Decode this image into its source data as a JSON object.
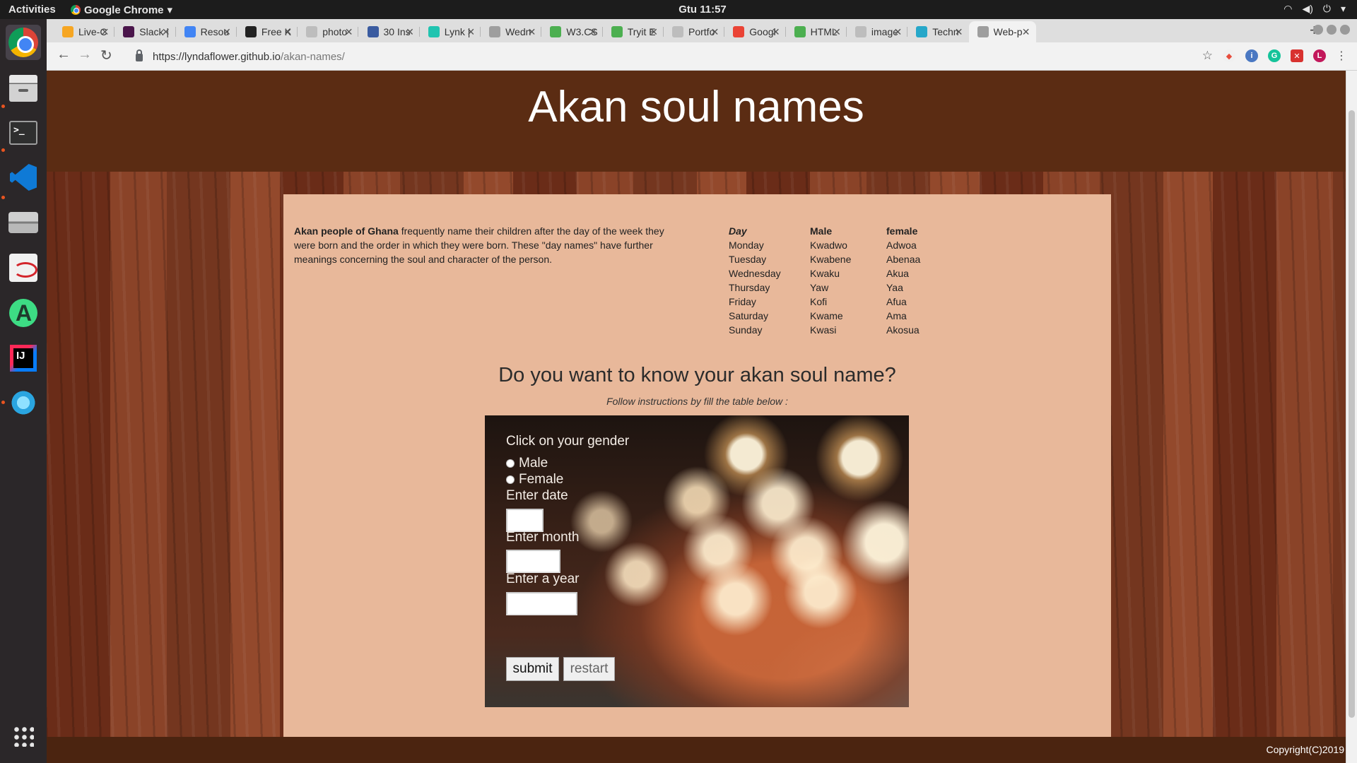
{
  "system": {
    "activities": "Activities",
    "app_name": "Google Chrome",
    "clock": "Gtu 11:57"
  },
  "dock": {
    "apps": [
      "chrome-icon",
      "files-icon",
      "terminal-icon",
      "vscode-icon",
      "scanner-icon",
      "document-viewer-icon",
      "android-studio-icon",
      "intellij-icon",
      "splash-app-icon",
      "show-applications-icon"
    ]
  },
  "browser": {
    "tabs": [
      {
        "title": "Live-C",
        "favicon_color": "#f6a623"
      },
      {
        "title": "Slack |",
        "favicon_color": "#4a154b"
      },
      {
        "title": "Resou",
        "favicon_color": "#4285f4"
      },
      {
        "title": "Free K",
        "favicon_color": "#222222"
      },
      {
        "title": "photo",
        "favicon_color": "#bdbdbd"
      },
      {
        "title": "30 Ins",
        "favicon_color": "#3a5ba0"
      },
      {
        "title": "Lynk |",
        "favicon_color": "#20c4b0"
      },
      {
        "title": "Wedn",
        "favicon_color": "#9e9e9e"
      },
      {
        "title": "W3.CS",
        "favicon_color": "#4caf50"
      },
      {
        "title": "Tryit E",
        "favicon_color": "#4caf50"
      },
      {
        "title": "Portfo",
        "favicon_color": "#bdbdbd"
      },
      {
        "title": "Googl",
        "favicon_color": "#ea4335"
      },
      {
        "title": "HTML",
        "favicon_color": "#4caf50"
      },
      {
        "title": "image",
        "favicon_color": "#bdbdbd"
      },
      {
        "title": "Techn",
        "favicon_color": "#26a7c9"
      },
      {
        "title": "Web-p",
        "favicon_color": "#9e9e9e"
      }
    ],
    "active_tab_index": 15,
    "url_host": "https://lyndaflower.github.io",
    "url_path": "/akan-names/"
  },
  "page": {
    "title": "Akan soul names",
    "intro_bold": "Akan people of Ghana",
    "intro_text": " frequently name their children after the day of the week they were born and the order in which they were born. These \"day names\" have further meanings concerning the soul and character of the person.",
    "table": {
      "headers": [
        "Day",
        "Male",
        "female"
      ],
      "rows": [
        [
          "Monday",
          "Kwadwo",
          "Adwoa"
        ],
        [
          "Tuesday",
          "Kwabene",
          "Abenaa"
        ],
        [
          "Wednesday",
          "Kwaku",
          "Akua"
        ],
        [
          "Thursday",
          "Yaw",
          "Yaa"
        ],
        [
          "Friday",
          "Kofi",
          "Afua"
        ],
        [
          "Saturday",
          "Kwame",
          "Ama"
        ],
        [
          "Sunday",
          "Kwasi",
          "Akosua"
        ]
      ]
    },
    "question": "Do you want to know your akan soul name?",
    "instructions": "Follow instructions by fill the table below :",
    "form": {
      "gender_label": "Click on your gender",
      "male_label": "Male",
      "female_label": "Female",
      "date_label": "Enter date",
      "month_label": "Enter month",
      "year_label": "Enter a year",
      "date_value": "",
      "month_value": "",
      "year_value": "",
      "submit_label": "submit",
      "restart_label": "restart"
    },
    "footer": "Copyright(C)2019"
  },
  "colors": {
    "header_bg": "#5b2c13",
    "content_bg": "#e8b89a",
    "footer_bg": "#4b2410"
  }
}
